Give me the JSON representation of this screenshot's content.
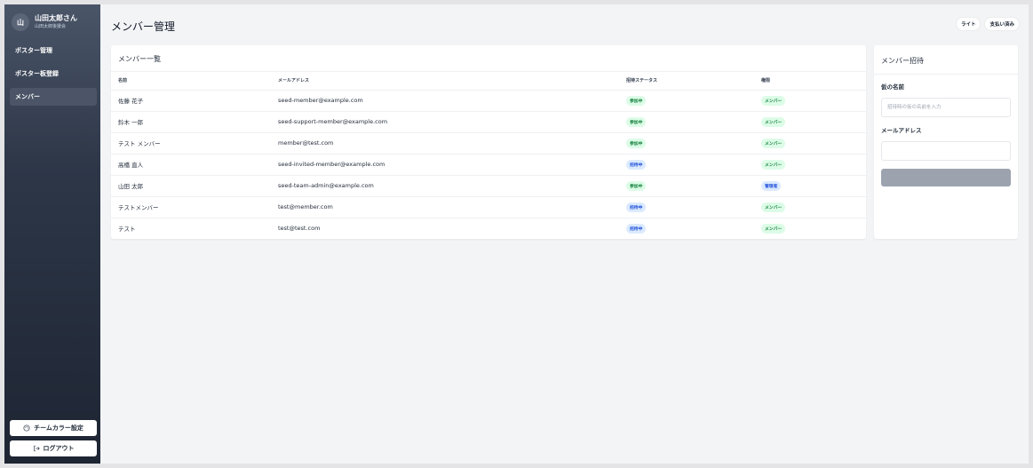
{
  "sidebar": {
    "avatar": "山",
    "user_name": "山田太郎さん",
    "org_name": "山田太郎後援会",
    "nav": [
      {
        "label": "ポスター管理"
      },
      {
        "label": "ポスター板登録"
      },
      {
        "label": "メンバー"
      }
    ],
    "team_color_label": "チームカラー設定",
    "logout_label": "ログアウト"
  },
  "header": {
    "title": "メンバー管理",
    "theme_label": "ライト",
    "payment_label": "支払い済み"
  },
  "members": {
    "title": "メンバー一覧",
    "columns": [
      "名前",
      "メールアドレス",
      "招待ステータス",
      "権限"
    ],
    "rows": [
      {
        "name": "佐藤 花子",
        "email": "seed-member@example.com",
        "status": "参加中",
        "role": "メンバー"
      },
      {
        "name": "鈴木 一郎",
        "email": "seed-support-member@example.com",
        "status": "参加中",
        "role": "メンバー"
      },
      {
        "name": "テスト メンバー",
        "email": "member@test.com",
        "status": "参加中",
        "role": "メンバー"
      },
      {
        "name": "高橋 直人",
        "email": "seed-invited-member@example.com",
        "status": "招待中",
        "role": "メンバー"
      },
      {
        "name": "山田 太郎",
        "email": "seed-team-admin@example.com",
        "status": "参加中",
        "role": "管理者"
      },
      {
        "name": "テストメンバー",
        "email": "test@member.com",
        "status": "招待中",
        "role": "メンバー"
      },
      {
        "name": "テスト",
        "email": "test@test.com",
        "status": "招待中",
        "role": "メンバー"
      }
    ]
  },
  "invite": {
    "title": "メンバー招待",
    "name_label": "仮の名前",
    "name_placeholder": "招待時の仮の名前を入力",
    "name_value": "",
    "email_label": "メールアドレス",
    "email_value": "",
    "submit_label": ""
  },
  "colors": {
    "badge_active_bg": "#dcfce7",
    "badge_active_fg": "#15803d",
    "badge_invited_bg": "#dbeafe",
    "badge_invited_fg": "#1d4ed8",
    "submit_disabled": "#9ca3af"
  }
}
